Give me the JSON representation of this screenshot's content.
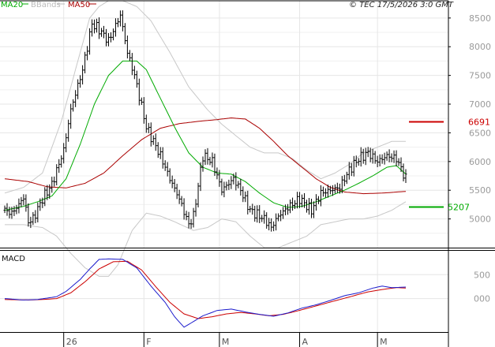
{
  "legend": {
    "ma20": "MA20",
    "bbands": "BBands",
    "ma50": "MA50"
  },
  "timestamp": "© TEC 17/5/2026 3:0 GMT",
  "macd_label": "MACD",
  "colors": {
    "ma20": "#00aa00",
    "bbands": "#c8c8c8",
    "ma50": "#aa0000",
    "macd": "#1a1acc",
    "signal": "#cc0000",
    "resistance": "#cc0000",
    "support": "#00aa00",
    "bars": "#000000",
    "frame": "#000000",
    "grid": "#e6e6e6"
  },
  "chart_data": [
    {
      "type": "line",
      "title": "",
      "description_of_marks": "daily price bars (high-low) with MA20, MA50, Bollinger bands and two horizontal levels",
      "ylim": [
        4500,
        8800
      ],
      "yticks": [
        5000,
        5500,
        6000,
        6500,
        7000,
        7500,
        8000,
        8500
      ],
      "ytick_labels": [
        "5000",
        "5500",
        "6000",
        "6500",
        "7000",
        "7500",
        "8000",
        "8500"
      ],
      "x_labels": [
        "26",
        "F",
        "M",
        "A",
        "M"
      ],
      "x_label_bar_index": [
        25,
        59,
        91,
        125,
        158
      ],
      "bar_count": 170,
      "levels": [
        {
          "name": "resistance",
          "value": 6691,
          "label": "6691"
        },
        {
          "name": "support",
          "value": 5207,
          "label": "5207"
        }
      ],
      "price_keypoints": [
        [
          0,
          5150
        ],
        [
          3,
          5100
        ],
        [
          6,
          5250
        ],
        [
          8,
          5380
        ],
        [
          10,
          4950
        ],
        [
          12,
          5000
        ],
        [
          16,
          5350
        ],
        [
          20,
          5600
        ],
        [
          25,
          6200
        ],
        [
          28,
          6900
        ],
        [
          33,
          7600
        ],
        [
          37,
          8400
        ],
        [
          40,
          8300
        ],
        [
          44,
          8100
        ],
        [
          49,
          8550
        ],
        [
          52,
          7900
        ],
        [
          55,
          7500
        ],
        [
          60,
          6600
        ],
        [
          66,
          6100
        ],
        [
          70,
          5700
        ],
        [
          74,
          5350
        ],
        [
          78,
          4900
        ],
        [
          80,
          5050
        ],
        [
          84,
          6100
        ],
        [
          88,
          6000
        ],
        [
          92,
          5500
        ],
        [
          97,
          5700
        ],
        [
          100,
          5500
        ],
        [
          104,
          5150
        ],
        [
          110,
          5000
        ],
        [
          113,
          4850
        ],
        [
          116,
          5050
        ],
        [
          120,
          5200
        ],
        [
          125,
          5350
        ],
        [
          130,
          5150
        ],
        [
          134,
          5450
        ],
        [
          138,
          5500
        ],
        [
          142,
          5550
        ],
        [
          146,
          5850
        ],
        [
          150,
          6050
        ],
        [
          154,
          6150
        ],
        [
          158,
          6000
        ],
        [
          162,
          6100
        ],
        [
          166,
          6050
        ],
        [
          170,
          5700
        ]
      ],
      "ma20_keypoints": [
        [
          0,
          5150
        ],
        [
          8,
          5220
        ],
        [
          14,
          5300
        ],
        [
          20,
          5400
        ],
        [
          26,
          5700
        ],
        [
          32,
          6300
        ],
        [
          38,
          7000
        ],
        [
          44,
          7500
        ],
        [
          50,
          7750
        ],
        [
          56,
          7750
        ],
        [
          60,
          7600
        ],
        [
          66,
          7100
        ],
        [
          72,
          6600
        ],
        [
          78,
          6150
        ],
        [
          84,
          5900
        ],
        [
          90,
          5800
        ],
        [
          96,
          5780
        ],
        [
          102,
          5650
        ],
        [
          108,
          5450
        ],
        [
          114,
          5280
        ],
        [
          120,
          5200
        ],
        [
          126,
          5220
        ],
        [
          132,
          5300
        ],
        [
          138,
          5400
        ],
        [
          144,
          5500
        ],
        [
          150,
          5620
        ],
        [
          156,
          5750
        ],
        [
          162,
          5900
        ],
        [
          166,
          5930
        ],
        [
          170,
          5780
        ]
      ],
      "ma50_keypoints": [
        [
          0,
          5700
        ],
        [
          10,
          5650
        ],
        [
          18,
          5560
        ],
        [
          26,
          5540
        ],
        [
          34,
          5620
        ],
        [
          42,
          5800
        ],
        [
          50,
          6100
        ],
        [
          58,
          6380
        ],
        [
          66,
          6580
        ],
        [
          74,
          6660
        ],
        [
          82,
          6700
        ],
        [
          90,
          6730
        ],
        [
          96,
          6760
        ],
        [
          102,
          6740
        ],
        [
          108,
          6580
        ],
        [
          114,
          6350
        ],
        [
          120,
          6100
        ],
        [
          126,
          5900
        ],
        [
          132,
          5700
        ],
        [
          138,
          5550
        ],
        [
          144,
          5470
        ],
        [
          152,
          5440
        ],
        [
          160,
          5450
        ],
        [
          170,
          5480
        ]
      ],
      "bb_upper_keypoints": [
        [
          0,
          5450
        ],
        [
          8,
          5550
        ],
        [
          16,
          5800
        ],
        [
          24,
          6700
        ],
        [
          30,
          7600
        ],
        [
          36,
          8500
        ],
        [
          40,
          8700
        ],
        [
          44,
          8800
        ],
        [
          50,
          8800
        ],
        [
          56,
          8700
        ],
        [
          62,
          8450
        ],
        [
          70,
          7900
        ],
        [
          78,
          7300
        ],
        [
          86,
          6900
        ],
        [
          92,
          6650
        ],
        [
          98,
          6450
        ],
        [
          104,
          6250
        ],
        [
          110,
          6150
        ],
        [
          116,
          6150
        ],
        [
          122,
          6050
        ],
        [
          128,
          5850
        ],
        [
          134,
          5700
        ],
        [
          140,
          5800
        ],
        [
          146,
          5950
        ],
        [
          152,
          6150
        ],
        [
          158,
          6250
        ],
        [
          164,
          6350
        ],
        [
          170,
          6350
        ]
      ],
      "bb_lower_keypoints": [
        [
          0,
          4900
        ],
        [
          8,
          4900
        ],
        [
          16,
          4850
        ],
        [
          22,
          4700
        ],
        [
          28,
          4400
        ],
        [
          34,
          4150
        ],
        [
          40,
          4000
        ],
        [
          44,
          4000
        ],
        [
          48,
          4200
        ],
        [
          54,
          4800
        ],
        [
          60,
          5100
        ],
        [
          66,
          5050
        ],
        [
          72,
          4950
        ],
        [
          80,
          4800
        ],
        [
          86,
          4850
        ],
        [
          92,
          5000
        ],
        [
          98,
          4950
        ],
        [
          104,
          4700
        ],
        [
          110,
          4500
        ],
        [
          116,
          4500
        ],
        [
          122,
          4600
        ],
        [
          128,
          4700
        ],
        [
          134,
          4900
        ],
        [
          140,
          4950
        ],
        [
          146,
          5000
        ],
        [
          152,
          5000
        ],
        [
          158,
          5050
        ],
        [
          164,
          5150
        ],
        [
          170,
          5300
        ]
      ]
    },
    {
      "type": "line",
      "title": "MACD",
      "ylim": [
        -700,
        1000
      ],
      "yticks": [
        0,
        500
      ],
      "ytick_labels": [
        "000",
        "500"
      ],
      "series": [
        {
          "name": "MACD",
          "color": "#1a1acc",
          "keypoints": [
            [
              0,
              0
            ],
            [
              8,
              -30
            ],
            [
              14,
              -20
            ],
            [
              18,
              10
            ],
            [
              22,
              40
            ],
            [
              26,
              150
            ],
            [
              32,
              400
            ],
            [
              36,
              620
            ],
            [
              40,
              820
            ],
            [
              44,
              830
            ],
            [
              50,
              820
            ],
            [
              56,
              640
            ],
            [
              62,
              260
            ],
            [
              68,
              -80
            ],
            [
              72,
              -380
            ],
            [
              76,
              -600
            ],
            [
              80,
              -480
            ],
            [
              84,
              -360
            ],
            [
              90,
              -250
            ],
            [
              96,
              -220
            ],
            [
              102,
              -280
            ],
            [
              108,
              -330
            ],
            [
              114,
              -370
            ],
            [
              120,
              -300
            ],
            [
              126,
              -200
            ],
            [
              132,
              -130
            ],
            [
              138,
              -40
            ],
            [
              144,
              60
            ],
            [
              150,
              120
            ],
            [
              156,
              220
            ],
            [
              160,
              260
            ],
            [
              164,
              230
            ],
            [
              170,
              240
            ]
          ]
        },
        {
          "name": "Signal",
          "color": "#cc0000",
          "keypoints": [
            [
              0,
              -20
            ],
            [
              10,
              -30
            ],
            [
              16,
              -20
            ],
            [
              22,
              0
            ],
            [
              28,
              120
            ],
            [
              34,
              350
            ],
            [
              40,
              620
            ],
            [
              46,
              770
            ],
            [
              52,
              780
            ],
            [
              58,
              600
            ],
            [
              64,
              250
            ],
            [
              70,
              -80
            ],
            [
              76,
              -320
            ],
            [
              82,
              -420
            ],
            [
              88,
              -380
            ],
            [
              94,
              -320
            ],
            [
              100,
              -290
            ],
            [
              106,
              -320
            ],
            [
              112,
              -360
            ],
            [
              118,
              -330
            ],
            [
              124,
              -260
            ],
            [
              130,
              -180
            ],
            [
              136,
              -100
            ],
            [
              142,
              -20
            ],
            [
              148,
              60
            ],
            [
              154,
              140
            ],
            [
              160,
              190
            ],
            [
              166,
              230
            ],
            [
              170,
              220
            ]
          ]
        }
      ]
    }
  ]
}
